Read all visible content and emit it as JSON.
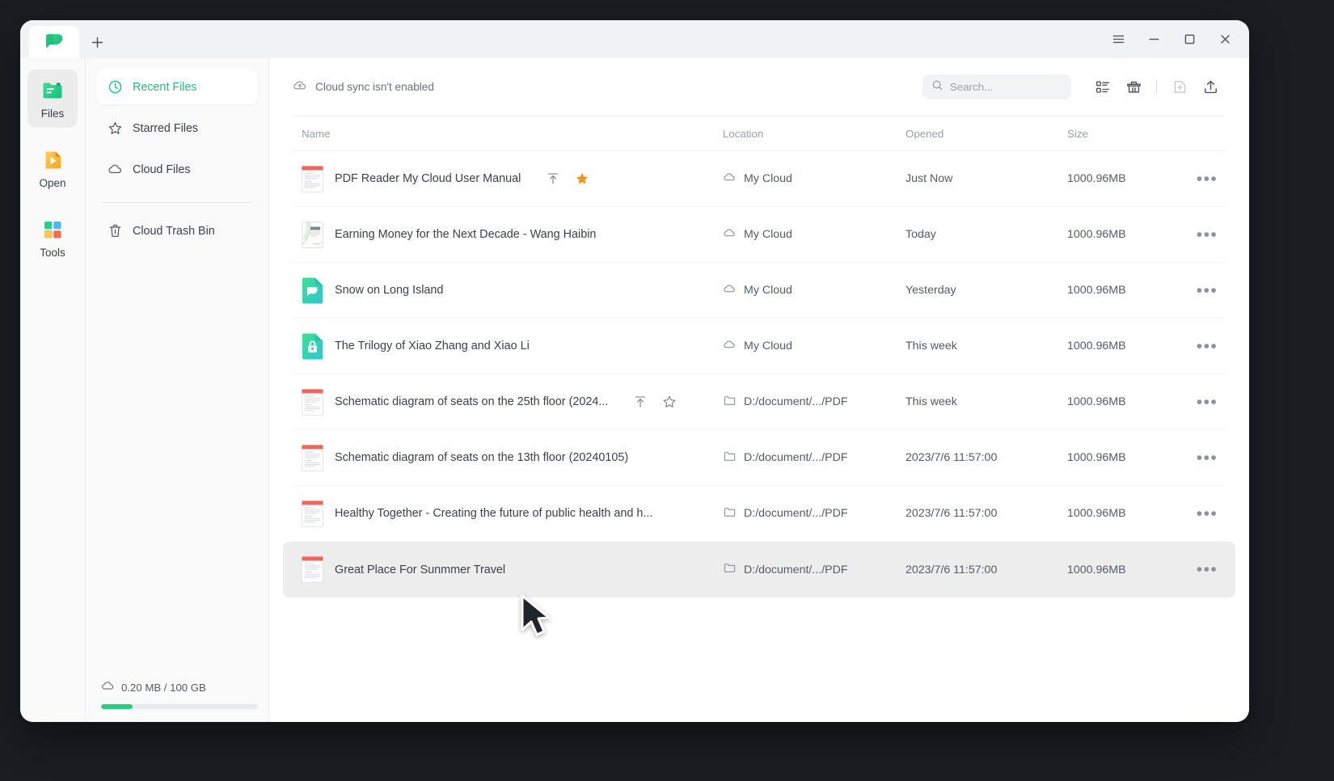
{
  "app": {
    "tab_logo": "app-logo",
    "new_tab_label": "+"
  },
  "window_controls": {
    "menu": "menu-icon",
    "minimize": "minimize-icon",
    "maximize": "maximize-icon",
    "close": "close-icon"
  },
  "rail": {
    "items": [
      {
        "label": "Files",
        "icon": "files-icon",
        "active": true
      },
      {
        "label": "Open",
        "icon": "open-icon",
        "active": false
      },
      {
        "label": "Tools",
        "icon": "tools-icon",
        "active": false
      }
    ]
  },
  "nav": {
    "items": [
      {
        "label": "Recent Files",
        "icon": "clock-icon",
        "active": true
      },
      {
        "label": "Starred Files",
        "icon": "star-icon",
        "active": false
      },
      {
        "label": "Cloud Files",
        "icon": "cloud-icon",
        "active": false
      },
      {
        "label": "Cloud Trash Bin",
        "icon": "trash-icon",
        "active": false
      }
    ],
    "storage": {
      "text": "0.20 MB / 100 GB",
      "used_percent": 20,
      "icon": "cloud-icon",
      "accent": "#2ecc83"
    }
  },
  "toolbar": {
    "sync_message": "Cloud sync isn't enabled",
    "sync_icon": "cloud-upload-icon",
    "search_placeholder": "Search...",
    "search_value": "",
    "search_icon": "search-icon",
    "buttons": [
      {
        "name": "view-mode-button",
        "icon": "list-view-icon"
      },
      {
        "name": "trash-button",
        "icon": "trash-bin-icon"
      },
      {
        "name": "new-file-button",
        "icon": "new-file-icon"
      },
      {
        "name": "share-button",
        "icon": "share-upload-icon"
      }
    ]
  },
  "table": {
    "columns": {
      "name": "Name",
      "location": "Location",
      "opened": "Opened",
      "size": "Size"
    },
    "rows": [
      {
        "name": "PDF Reader My Cloud User Manual",
        "icon": "pdf-document-icon",
        "location": "My Cloud",
        "location_icon": "cloud-icon",
        "opened": "Just Now",
        "size": "1000.96MB",
        "show_actions": true,
        "starred": true,
        "selected": false
      },
      {
        "name": "Earning Money for the Next Decade - Wang Haibin",
        "icon": "book-cover-icon",
        "location": "My Cloud",
        "location_icon": "cloud-icon",
        "opened": "Today",
        "size": "1000.96MB",
        "show_actions": false,
        "starred": false,
        "selected": false
      },
      {
        "name": "Snow on Long Island",
        "icon": "app-document-icon",
        "location": "My Cloud",
        "location_icon": "cloud-icon",
        "opened": "Yesterday",
        "size": "1000.96MB",
        "show_actions": false,
        "starred": false,
        "selected": false
      },
      {
        "name": "The Trilogy of Xiao Zhang and Xiao Li",
        "icon": "locked-document-icon",
        "location": "My Cloud",
        "location_icon": "cloud-icon",
        "opened": "This week",
        "size": "1000.96MB",
        "show_actions": false,
        "starred": false,
        "selected": false
      },
      {
        "name": "Schematic diagram of seats on the 25th floor (2024...",
        "icon": "pdf-document-icon",
        "location": "D:/document/.../PDF",
        "location_icon": "folder-icon",
        "opened": "This week",
        "size": "1000.96MB",
        "show_actions": true,
        "starred": false,
        "selected": false
      },
      {
        "name": "Schematic diagram of seats on the 13th floor (20240105)",
        "icon": "pdf-document-icon",
        "location": "D:/document/.../PDF",
        "location_icon": "folder-icon",
        "opened": "2023/7/6 11:57:00",
        "size": "1000.96MB",
        "show_actions": false,
        "starred": false,
        "selected": false
      },
      {
        "name": "Healthy Together - Creating the future of public health and h...",
        "icon": "pdf-document-icon",
        "location": "D:/document/.../PDF",
        "location_icon": "folder-icon",
        "opened": "2023/7/6 11:57:00",
        "size": "1000.96MB",
        "show_actions": false,
        "starred": false,
        "selected": false
      },
      {
        "name": "Great Place For Sunmmer Travel",
        "icon": "pdf-document-icon",
        "location": "D:/document/.../PDF",
        "location_icon": "folder-icon",
        "opened": "2023/7/6 11:57:00",
        "size": "1000.96MB",
        "show_actions": false,
        "starred": false,
        "selected": true
      }
    ],
    "more_glyph": "•••"
  },
  "colors": {
    "brand_green": "#2ecc83",
    "star_orange": "#f5921e",
    "selected_row": "#ededed"
  }
}
